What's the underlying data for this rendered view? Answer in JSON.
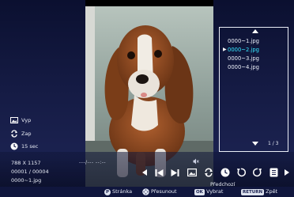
{
  "photo": {
    "subject": "dog-photo"
  },
  "file_list": {
    "items": [
      "0000~1.jpg",
      "0000~2.jpg",
      "0000~3.jpg",
      "0000~4.jpg"
    ],
    "selected_index": 1,
    "page": "1 / 3"
  },
  "settings": {
    "effect": "Vyp",
    "repeat": "Zap",
    "interval": "15 sec"
  },
  "info": {
    "resolution": "788 X 1157",
    "counter": "00001 / 00004",
    "filename": "0000~1.jpg",
    "timeline": "---/---  --:--"
  },
  "controls": {
    "focused_label": "Předchozí"
  },
  "hints": {
    "page_key": "P",
    "page_label": "Stránka",
    "move_label": "Přesunout",
    "ok_key": "OK",
    "select_label": "Vybrat",
    "return_key": "RETURN",
    "back_label": "Zpět"
  },
  "colors": {
    "panel_bg": "#151b44",
    "selected_text": "#38e8ff",
    "hint_bar": "#10163d"
  }
}
